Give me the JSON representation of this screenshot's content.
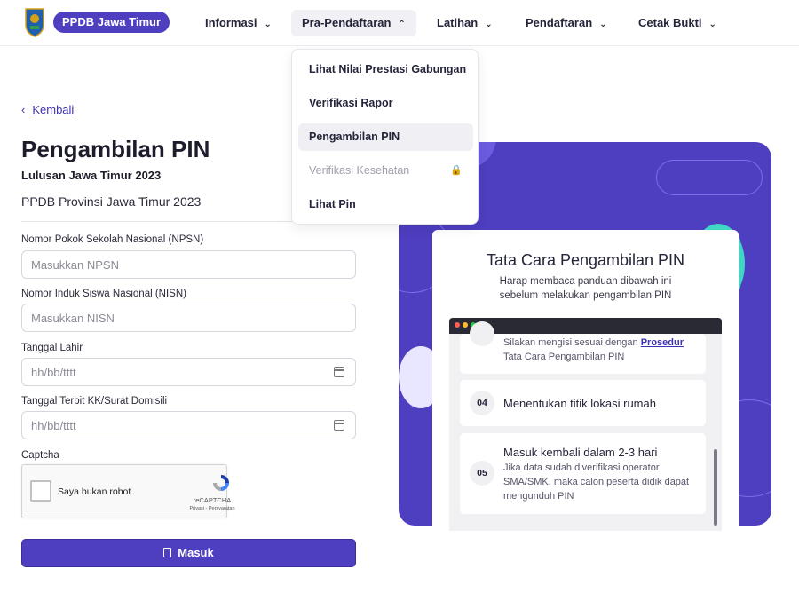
{
  "header": {
    "brand": "PPDB Jawa Timur",
    "nav": [
      {
        "label": "Informasi"
      },
      {
        "label": "Pra-Pendaftaran"
      },
      {
        "label": "Latihan"
      },
      {
        "label": "Pendaftaran"
      },
      {
        "label": "Cetak Bukti"
      }
    ]
  },
  "dropdown": {
    "items": [
      {
        "label": "Lihat Nilai Prestasi Gabungan"
      },
      {
        "label": "Verifikasi Rapor"
      },
      {
        "label": "Pengambilan PIN"
      },
      {
        "label": "Verifikasi Kesehatan"
      },
      {
        "label": "Lihat Pin"
      }
    ]
  },
  "page": {
    "back_label": "Kembali",
    "title": "Pengambilan PIN",
    "subtitle": "Lulusan Jawa Timur 2023",
    "org": "PPDB Provinsi Jawa Timur 2023"
  },
  "form": {
    "npsn_label": "Nomor Pokok Sekolah Nasional (NPSN)",
    "npsn_placeholder": "Masukkan NPSN",
    "nisn_label": "Nomor Induk Siswa Nasional (NISN)",
    "nisn_placeholder": "Masukkan NISN",
    "dob_label": "Tanggal Lahir",
    "dob_placeholder": "hh/bb/tttt",
    "kk_label": "Tanggal Terbit KK/Surat Domisili",
    "kk_placeholder": "hh/bb/tttt",
    "captcha_label": "Captcha",
    "captcha_text": "Saya bukan robot",
    "captcha_brand": "reCAPTCHA",
    "captcha_links": "Privasi - Persyaratan",
    "submit_label": "Masuk"
  },
  "guide": {
    "title": "Tata Cara Pengambilan PIN",
    "subtitle": "Harap membaca panduan dibawah ini sebelum melakukan pengambilan PIN",
    "step3_text_a": "Silakan mengisi sesuai dengan",
    "step3_link": "Prosedur",
    "step3_text_b": "Tata Cara Pengambilan PIN",
    "step4_num": "04",
    "step4_title": "Menentukan titik lokasi rumah",
    "step5_num": "05",
    "step5_title": "Masuk kembali dalam 2-3 hari",
    "step5_body": "Jika data sudah diverifikasi operator SMA/SMK, maka calon peserta didik dapat mengunduh PIN"
  },
  "colors": {
    "accent": "#4e3ec0",
    "teal": "#3fd6c4",
    "blob_violet": "#6b5ce0"
  }
}
